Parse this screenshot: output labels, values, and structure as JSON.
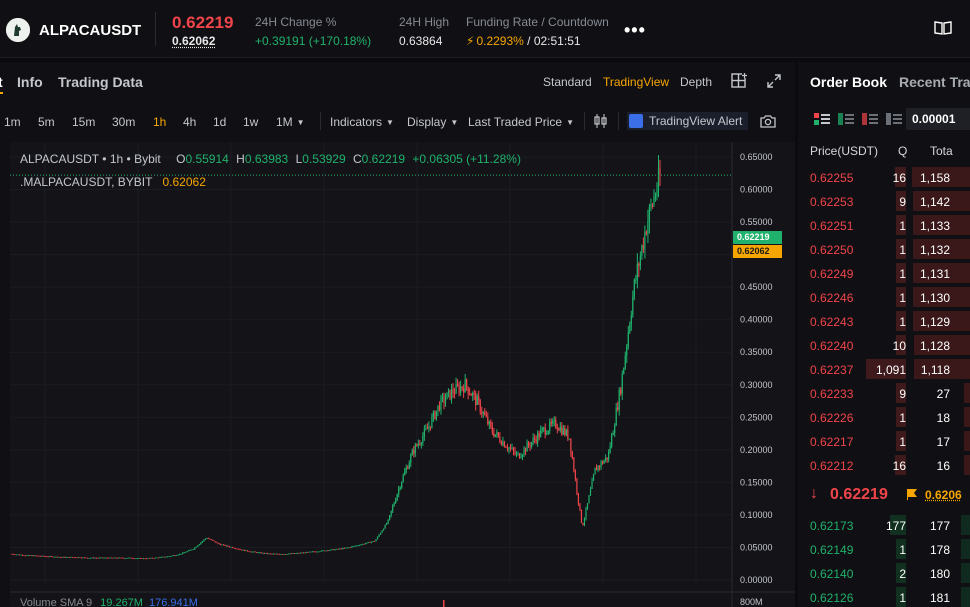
{
  "header": {
    "symbol": "ALPACAUSDT",
    "last_price": "0.62219",
    "mark_price": "0.62062",
    "change_label": "24H Change %",
    "change_value": "+0.39191 (+170.18%)",
    "high_label": "24H High",
    "high_value": "0.63864",
    "funding_label": "Funding Rate / Countdown",
    "funding_rate": "0.2293%",
    "countdown": "/ 02:51:51",
    "more_icon": "more-dots-icon",
    "book_icon": "book-icon"
  },
  "chart_panel": {
    "tabs": [
      {
        "label": "t"
      },
      {
        "label": "Info"
      },
      {
        "label": "Trading Data"
      }
    ],
    "views": [
      "Standard",
      "TradingView",
      "Depth"
    ],
    "active_view": "TradingView",
    "timeframes": [
      "1m",
      "5m",
      "15m",
      "30m",
      "1h",
      "4h",
      "1d",
      "1w",
      "1M"
    ],
    "active_timeframe": "1h",
    "menus": {
      "indicators": "Indicators",
      "display": "Display",
      "last_traded": "Last Traded Price"
    },
    "alert_label": "TradingView Alert"
  },
  "chart": {
    "legend": {
      "title": "ALPACAUSDT",
      "interval": "1h",
      "exchange": "Bybit",
      "o_key": "O",
      "o": "0.55914",
      "h_key": "H",
      "h": "0.63983",
      "l_key": "L",
      "l": "0.53929",
      "c_key": "C",
      "c": "0.62219",
      "change": "+0.06305 (+11.28%)"
    },
    "mark_legend": {
      "label": ".MALPACAUSDT, BYBIT",
      "value": "0.62062"
    },
    "volume_legend": {
      "label": "Volume SMA 9",
      "v1": "19.267M",
      "v2": "176.941M"
    },
    "last_tag": "0.62219",
    "mark_tag": "0.62062",
    "volume_axis_label": "800M",
    "up_color": "#20b26c",
    "down_color": "#ef454a"
  },
  "chart_data": {
    "type": "line",
    "title": "ALPACAUSDT · 1h · Bybit",
    "ylim": [
      0,
      0.65
    ],
    "yticks": [
      "0.65000",
      "0.60000",
      "0.55000",
      "0.50000",
      "0.45000",
      "0.40000",
      "0.35000",
      "0.30000",
      "0.25000",
      "0.20000",
      "0.15000",
      "0.10000",
      "0.05000",
      "0.00000"
    ],
    "series": [
      {
        "name": "ALPACAUSDT",
        "values": [
          0.04,
          0.038,
          0.037,
          0.036,
          0.035,
          0.035,
          0.034,
          0.034,
          0.034,
          0.034,
          0.033,
          0.034,
          0.036,
          0.04,
          0.048,
          0.065,
          0.055,
          0.05,
          0.045,
          0.042,
          0.04,
          0.04,
          0.041,
          0.043,
          0.045,
          0.047,
          0.05,
          0.055,
          0.06,
          0.09,
          0.15,
          0.2,
          0.23,
          0.27,
          0.29,
          0.3,
          0.27,
          0.23,
          0.21,
          0.19,
          0.21,
          0.23,
          0.24,
          0.22,
          0.08,
          0.17,
          0.19,
          0.3,
          0.45,
          0.55,
          0.62
        ]
      }
    ]
  },
  "orderbook": {
    "tabs": [
      "Order Book",
      "Recent Tra"
    ],
    "precision": "0.00001",
    "headers": {
      "price": "Price(USDT)",
      "qty": "Q",
      "total": "Tota"
    },
    "asks": [
      {
        "price": "0.62255",
        "qty": "16",
        "total": "1,158"
      },
      {
        "price": "0.62253",
        "qty": "9",
        "total": "1,142"
      },
      {
        "price": "0.62251",
        "qty": "1",
        "total": "1,133"
      },
      {
        "price": "0.62250",
        "qty": "1",
        "total": "1,132"
      },
      {
        "price": "0.62249",
        "qty": "1",
        "total": "1,131"
      },
      {
        "price": "0.62246",
        "qty": "1",
        "total": "1,130"
      },
      {
        "price": "0.62243",
        "qty": "1",
        "total": "1,129"
      },
      {
        "price": "0.62240",
        "qty": "10",
        "total": "1,128"
      },
      {
        "price": "0.62237",
        "qty": "1,091",
        "total": "1,118"
      },
      {
        "price": "0.62233",
        "qty": "9",
        "total": "27"
      },
      {
        "price": "0.62226",
        "qty": "1",
        "total": "18"
      },
      {
        "price": "0.62217",
        "qty": "1",
        "total": "17"
      },
      {
        "price": "0.62212",
        "qty": "16",
        "total": "16"
      }
    ],
    "mid_price": "0.62219",
    "mid_mark": "0.6206",
    "bids": [
      {
        "price": "0.62173",
        "qty": "177",
        "total": "177"
      },
      {
        "price": "0.62149",
        "qty": "1",
        "total": "178"
      },
      {
        "price": "0.62140",
        "qty": "2",
        "total": "180"
      },
      {
        "price": "0.62126",
        "qty": "1",
        "total": "181"
      }
    ]
  }
}
